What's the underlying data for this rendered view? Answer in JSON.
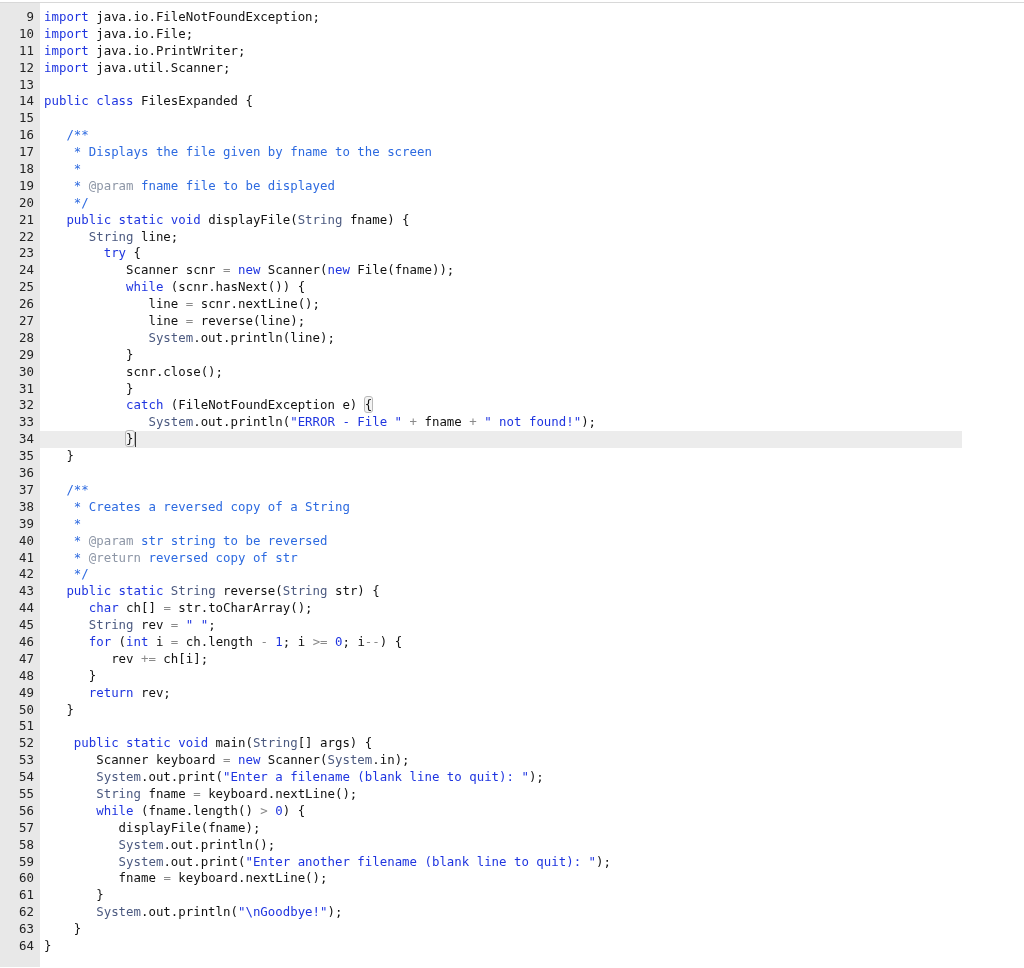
{
  "editor": {
    "lines": [
      {
        "number": "9",
        "current": false,
        "tokens": [
          {
            "kind": "kw",
            "text": "import"
          },
          {
            "kind": "plain",
            "text": " java.io.FileNotFoundException;"
          }
        ]
      },
      {
        "number": "10",
        "current": false,
        "tokens": [
          {
            "kind": "kw",
            "text": "import"
          },
          {
            "kind": "plain",
            "text": " java.io.File;"
          }
        ]
      },
      {
        "number": "11",
        "current": false,
        "tokens": [
          {
            "kind": "kw",
            "text": "import"
          },
          {
            "kind": "plain",
            "text": " java.io.PrintWriter;"
          }
        ]
      },
      {
        "number": "12",
        "current": false,
        "tokens": [
          {
            "kind": "kw",
            "text": "import"
          },
          {
            "kind": "plain",
            "text": " java.util.Scanner;"
          }
        ]
      },
      {
        "number": "13",
        "current": false
      },
      {
        "number": "14",
        "current": false,
        "tokens": [
          {
            "kind": "kw",
            "text": "public class"
          },
          {
            "kind": "plain",
            "text": " FilesExpanded {"
          }
        ]
      },
      {
        "number": "15",
        "current": false
      },
      {
        "number": "16",
        "current": false,
        "tokens": [
          {
            "kind": "cmt",
            "text": "   /**"
          }
        ]
      },
      {
        "number": "17",
        "current": false,
        "tokens": [
          {
            "kind": "cmt",
            "text": "    * Displays the file given by fname to the screen"
          }
        ]
      },
      {
        "number": "18",
        "current": false,
        "tokens": [
          {
            "kind": "cmt",
            "text": "    *"
          }
        ]
      },
      {
        "number": "19",
        "current": false,
        "tokens": [
          {
            "kind": "cmt",
            "text": "    * "
          },
          {
            "kind": "tag",
            "text": "@param"
          },
          {
            "kind": "cmt",
            "text": " fname file to be displayed"
          }
        ]
      },
      {
        "number": "20",
        "current": false,
        "tokens": [
          {
            "kind": "cmt",
            "text": "    */"
          }
        ]
      },
      {
        "number": "21",
        "current": false,
        "tokens": [
          {
            "kind": "kw",
            "text": "   public static void"
          },
          {
            "kind": "plain",
            "text": " displayFile("
          },
          {
            "kind": "type",
            "text": "String"
          },
          {
            "kind": "plain",
            "text": " fname) {"
          }
        ]
      },
      {
        "number": "22",
        "current": false,
        "tokens": [
          {
            "kind": "type",
            "text": "      String"
          },
          {
            "kind": "plain",
            "text": " line;"
          }
        ]
      },
      {
        "number": "23",
        "current": false,
        "tokens": [
          {
            "kind": "kw",
            "text": "        try"
          },
          {
            "kind": "plain",
            "text": " {"
          }
        ]
      },
      {
        "number": "24",
        "current": false,
        "tokens": [
          {
            "kind": "plain",
            "text": "           Scanner scnr "
          },
          {
            "kind": "op",
            "text": "="
          },
          {
            "kind": "kw",
            "text": " new"
          },
          {
            "kind": "plain",
            "text": " Scanner("
          },
          {
            "kind": "kw",
            "text": "new"
          },
          {
            "kind": "plain",
            "text": " File(fname));"
          }
        ]
      },
      {
        "number": "25",
        "current": false,
        "tokens": [
          {
            "kind": "kw",
            "text": "           while"
          },
          {
            "kind": "plain",
            "text": " (scnr.hasNext()) {"
          }
        ]
      },
      {
        "number": "26",
        "current": false,
        "tokens": [
          {
            "kind": "plain",
            "text": "              line "
          },
          {
            "kind": "op",
            "text": "="
          },
          {
            "kind": "plain",
            "text": " scnr.nextLine();"
          }
        ]
      },
      {
        "number": "27",
        "current": false,
        "tokens": [
          {
            "kind": "plain",
            "text": "              line "
          },
          {
            "kind": "op",
            "text": "="
          },
          {
            "kind": "plain",
            "text": " reverse(line);"
          }
        ]
      },
      {
        "number": "28",
        "current": false,
        "tokens": [
          {
            "kind": "type",
            "text": "              System"
          },
          {
            "kind": "plain",
            "text": ".out.println(line);"
          }
        ]
      },
      {
        "number": "29",
        "current": false,
        "tokens": [
          {
            "kind": "plain",
            "text": "           }"
          }
        ]
      },
      {
        "number": "30",
        "current": false,
        "tokens": [
          {
            "kind": "plain",
            "text": "           scnr.close();"
          }
        ]
      },
      {
        "number": "31",
        "current": false,
        "tokens": [
          {
            "kind": "plain",
            "text": "           }"
          }
        ]
      },
      {
        "number": "32",
        "current": false,
        "tokens": [
          {
            "kind": "kw",
            "text": "           catch"
          },
          {
            "kind": "plain",
            "text": " (FileNotFoundException e) "
          },
          {
            "kind": "match",
            "text": "{"
          }
        ]
      },
      {
        "number": "33",
        "current": false,
        "tokens": [
          {
            "kind": "type",
            "text": "              System"
          },
          {
            "kind": "plain",
            "text": ".out.println("
          },
          {
            "kind": "str",
            "text": "\"ERROR - File \""
          },
          {
            "kind": "op",
            "text": " +"
          },
          {
            "kind": "plain",
            "text": " fname "
          },
          {
            "kind": "op",
            "text": "+"
          },
          {
            "kind": "str",
            "text": " \" not found!\""
          },
          {
            "kind": "plain",
            "text": ");"
          }
        ]
      },
      {
        "number": "34",
        "current": true,
        "tokens": [
          {
            "kind": "match",
            "text": "           }"
          }
        ]
      },
      {
        "number": "35",
        "current": false,
        "tokens": [
          {
            "kind": "plain",
            "text": "   }"
          }
        ]
      },
      {
        "number": "36",
        "current": false
      },
      {
        "number": "37",
        "current": false,
        "tokens": [
          {
            "kind": "cmt",
            "text": "   /**"
          }
        ]
      },
      {
        "number": "38",
        "current": false,
        "tokens": [
          {
            "kind": "cmt",
            "text": "    * Creates a reversed copy of a String"
          }
        ]
      },
      {
        "number": "39",
        "current": false,
        "tokens": [
          {
            "kind": "cmt",
            "text": "    *"
          }
        ]
      },
      {
        "number": "40",
        "current": false,
        "tokens": [
          {
            "kind": "cmt",
            "text": "    * "
          },
          {
            "kind": "tag",
            "text": "@param"
          },
          {
            "kind": "cmt",
            "text": " str string to be reversed"
          }
        ]
      },
      {
        "number": "41",
        "current": false,
        "tokens": [
          {
            "kind": "cmt",
            "text": "    * "
          },
          {
            "kind": "tag",
            "text": "@return"
          },
          {
            "kind": "cmt",
            "text": " reversed copy of str"
          }
        ]
      },
      {
        "number": "42",
        "current": false,
        "tokens": [
          {
            "kind": "cmt",
            "text": "    */"
          }
        ]
      },
      {
        "number": "43",
        "current": false,
        "tokens": [
          {
            "kind": "kw",
            "text": "   public static"
          },
          {
            "kind": "type",
            "text": " String"
          },
          {
            "kind": "plain",
            "text": " reverse("
          },
          {
            "kind": "type",
            "text": "String"
          },
          {
            "kind": "plain",
            "text": " str) {"
          }
        ]
      },
      {
        "number": "44",
        "current": false,
        "tokens": [
          {
            "kind": "kw",
            "text": "      char"
          },
          {
            "kind": "plain",
            "text": " ch[] "
          },
          {
            "kind": "op",
            "text": "="
          },
          {
            "kind": "plain",
            "text": " str.toCharArray();"
          }
        ]
      },
      {
        "number": "45",
        "current": false,
        "tokens": [
          {
            "kind": "type",
            "text": "      String"
          },
          {
            "kind": "plain",
            "text": " rev "
          },
          {
            "kind": "op",
            "text": "="
          },
          {
            "kind": "str",
            "text": " \" \""
          },
          {
            "kind": "plain",
            "text": ";"
          }
        ]
      },
      {
        "number": "46",
        "current": false,
        "tokens": [
          {
            "kind": "kw",
            "text": "      for"
          },
          {
            "kind": "plain",
            "text": " ("
          },
          {
            "kind": "kw",
            "text": "int"
          },
          {
            "kind": "plain",
            "text": " i "
          },
          {
            "kind": "op",
            "text": "="
          },
          {
            "kind": "plain",
            "text": " ch.length "
          },
          {
            "kind": "op",
            "text": "-"
          },
          {
            "kind": "num",
            "text": " 1"
          },
          {
            "kind": "plain",
            "text": "; i "
          },
          {
            "kind": "op",
            "text": ">="
          },
          {
            "kind": "num",
            "text": " 0"
          },
          {
            "kind": "plain",
            "text": "; i"
          },
          {
            "kind": "op",
            "text": "--"
          },
          {
            "kind": "plain",
            "text": ") {"
          }
        ]
      },
      {
        "number": "47",
        "current": false,
        "tokens": [
          {
            "kind": "plain",
            "text": "         rev "
          },
          {
            "kind": "op",
            "text": "+="
          },
          {
            "kind": "plain",
            "text": " ch[i];"
          }
        ]
      },
      {
        "number": "48",
        "current": false,
        "tokens": [
          {
            "kind": "plain",
            "text": "      }"
          }
        ]
      },
      {
        "number": "49",
        "current": false,
        "tokens": [
          {
            "kind": "kw",
            "text": "      return"
          },
          {
            "kind": "plain",
            "text": " rev;"
          }
        ]
      },
      {
        "number": "50",
        "current": false,
        "tokens": [
          {
            "kind": "plain",
            "text": "   }"
          }
        ]
      },
      {
        "number": "51",
        "current": false
      },
      {
        "number": "52",
        "current": false,
        "tokens": [
          {
            "kind": "kw",
            "text": "    public static void"
          },
          {
            "kind": "plain",
            "text": " main("
          },
          {
            "kind": "type",
            "text": "String"
          },
          {
            "kind": "plain",
            "text": "[] args) {"
          }
        ]
      },
      {
        "number": "53",
        "current": false,
        "tokens": [
          {
            "kind": "plain",
            "text": "       Scanner keyboard "
          },
          {
            "kind": "op",
            "text": "="
          },
          {
            "kind": "kw",
            "text": " new"
          },
          {
            "kind": "plain",
            "text": " Scanner("
          },
          {
            "kind": "type",
            "text": "System"
          },
          {
            "kind": "plain",
            "text": ".in);"
          }
        ]
      },
      {
        "number": "54",
        "current": false,
        "tokens": [
          {
            "kind": "type",
            "text": "       System"
          },
          {
            "kind": "plain",
            "text": ".out.print("
          },
          {
            "kind": "str",
            "text": "\"Enter a filename (blank line to quit): \""
          },
          {
            "kind": "plain",
            "text": ");"
          }
        ]
      },
      {
        "number": "55",
        "current": false,
        "tokens": [
          {
            "kind": "type",
            "text": "       String"
          },
          {
            "kind": "plain",
            "text": " fname "
          },
          {
            "kind": "op",
            "text": "="
          },
          {
            "kind": "plain",
            "text": " keyboard.nextLine();"
          }
        ]
      },
      {
        "number": "56",
        "current": false,
        "tokens": [
          {
            "kind": "kw",
            "text": "       while"
          },
          {
            "kind": "plain",
            "text": " (fname.length() "
          },
          {
            "kind": "op",
            "text": ">"
          },
          {
            "kind": "num",
            "text": " 0"
          },
          {
            "kind": "plain",
            "text": ") {"
          }
        ]
      },
      {
        "number": "57",
        "current": false,
        "tokens": [
          {
            "kind": "plain",
            "text": "          displayFile(fname);"
          }
        ]
      },
      {
        "number": "58",
        "current": false,
        "tokens": [
          {
            "kind": "type",
            "text": "          System"
          },
          {
            "kind": "plain",
            "text": ".out.println();"
          }
        ]
      },
      {
        "number": "59",
        "current": false,
        "tokens": [
          {
            "kind": "type",
            "text": "          System"
          },
          {
            "kind": "plain",
            "text": ".out.print("
          },
          {
            "kind": "str",
            "text": "\"Enter another filename (blank line to quit): \""
          },
          {
            "kind": "plain",
            "text": ");"
          }
        ]
      },
      {
        "number": "60",
        "current": false,
        "tokens": [
          {
            "kind": "plain",
            "text": "          fname "
          },
          {
            "kind": "op",
            "text": "="
          },
          {
            "kind": "plain",
            "text": " keyboard.nextLine();"
          }
        ]
      },
      {
        "number": "61",
        "current": false,
        "tokens": [
          {
            "kind": "plain",
            "text": "       }"
          }
        ]
      },
      {
        "number": "62",
        "current": false,
        "tokens": [
          {
            "kind": "type",
            "text": "       System"
          },
          {
            "kind": "plain",
            "text": ".out.println("
          },
          {
            "kind": "str",
            "text": "\"\\nGoodbye!\""
          },
          {
            "kind": "plain",
            "text": ");"
          }
        ]
      },
      {
        "number": "63",
        "current": false,
        "tokens": [
          {
            "kind": "plain",
            "text": "    }"
          }
        ]
      },
      {
        "number": "64",
        "current": false,
        "tokens": [
          {
            "kind": "plain",
            "text": "}"
          }
        ]
      }
    ]
  }
}
